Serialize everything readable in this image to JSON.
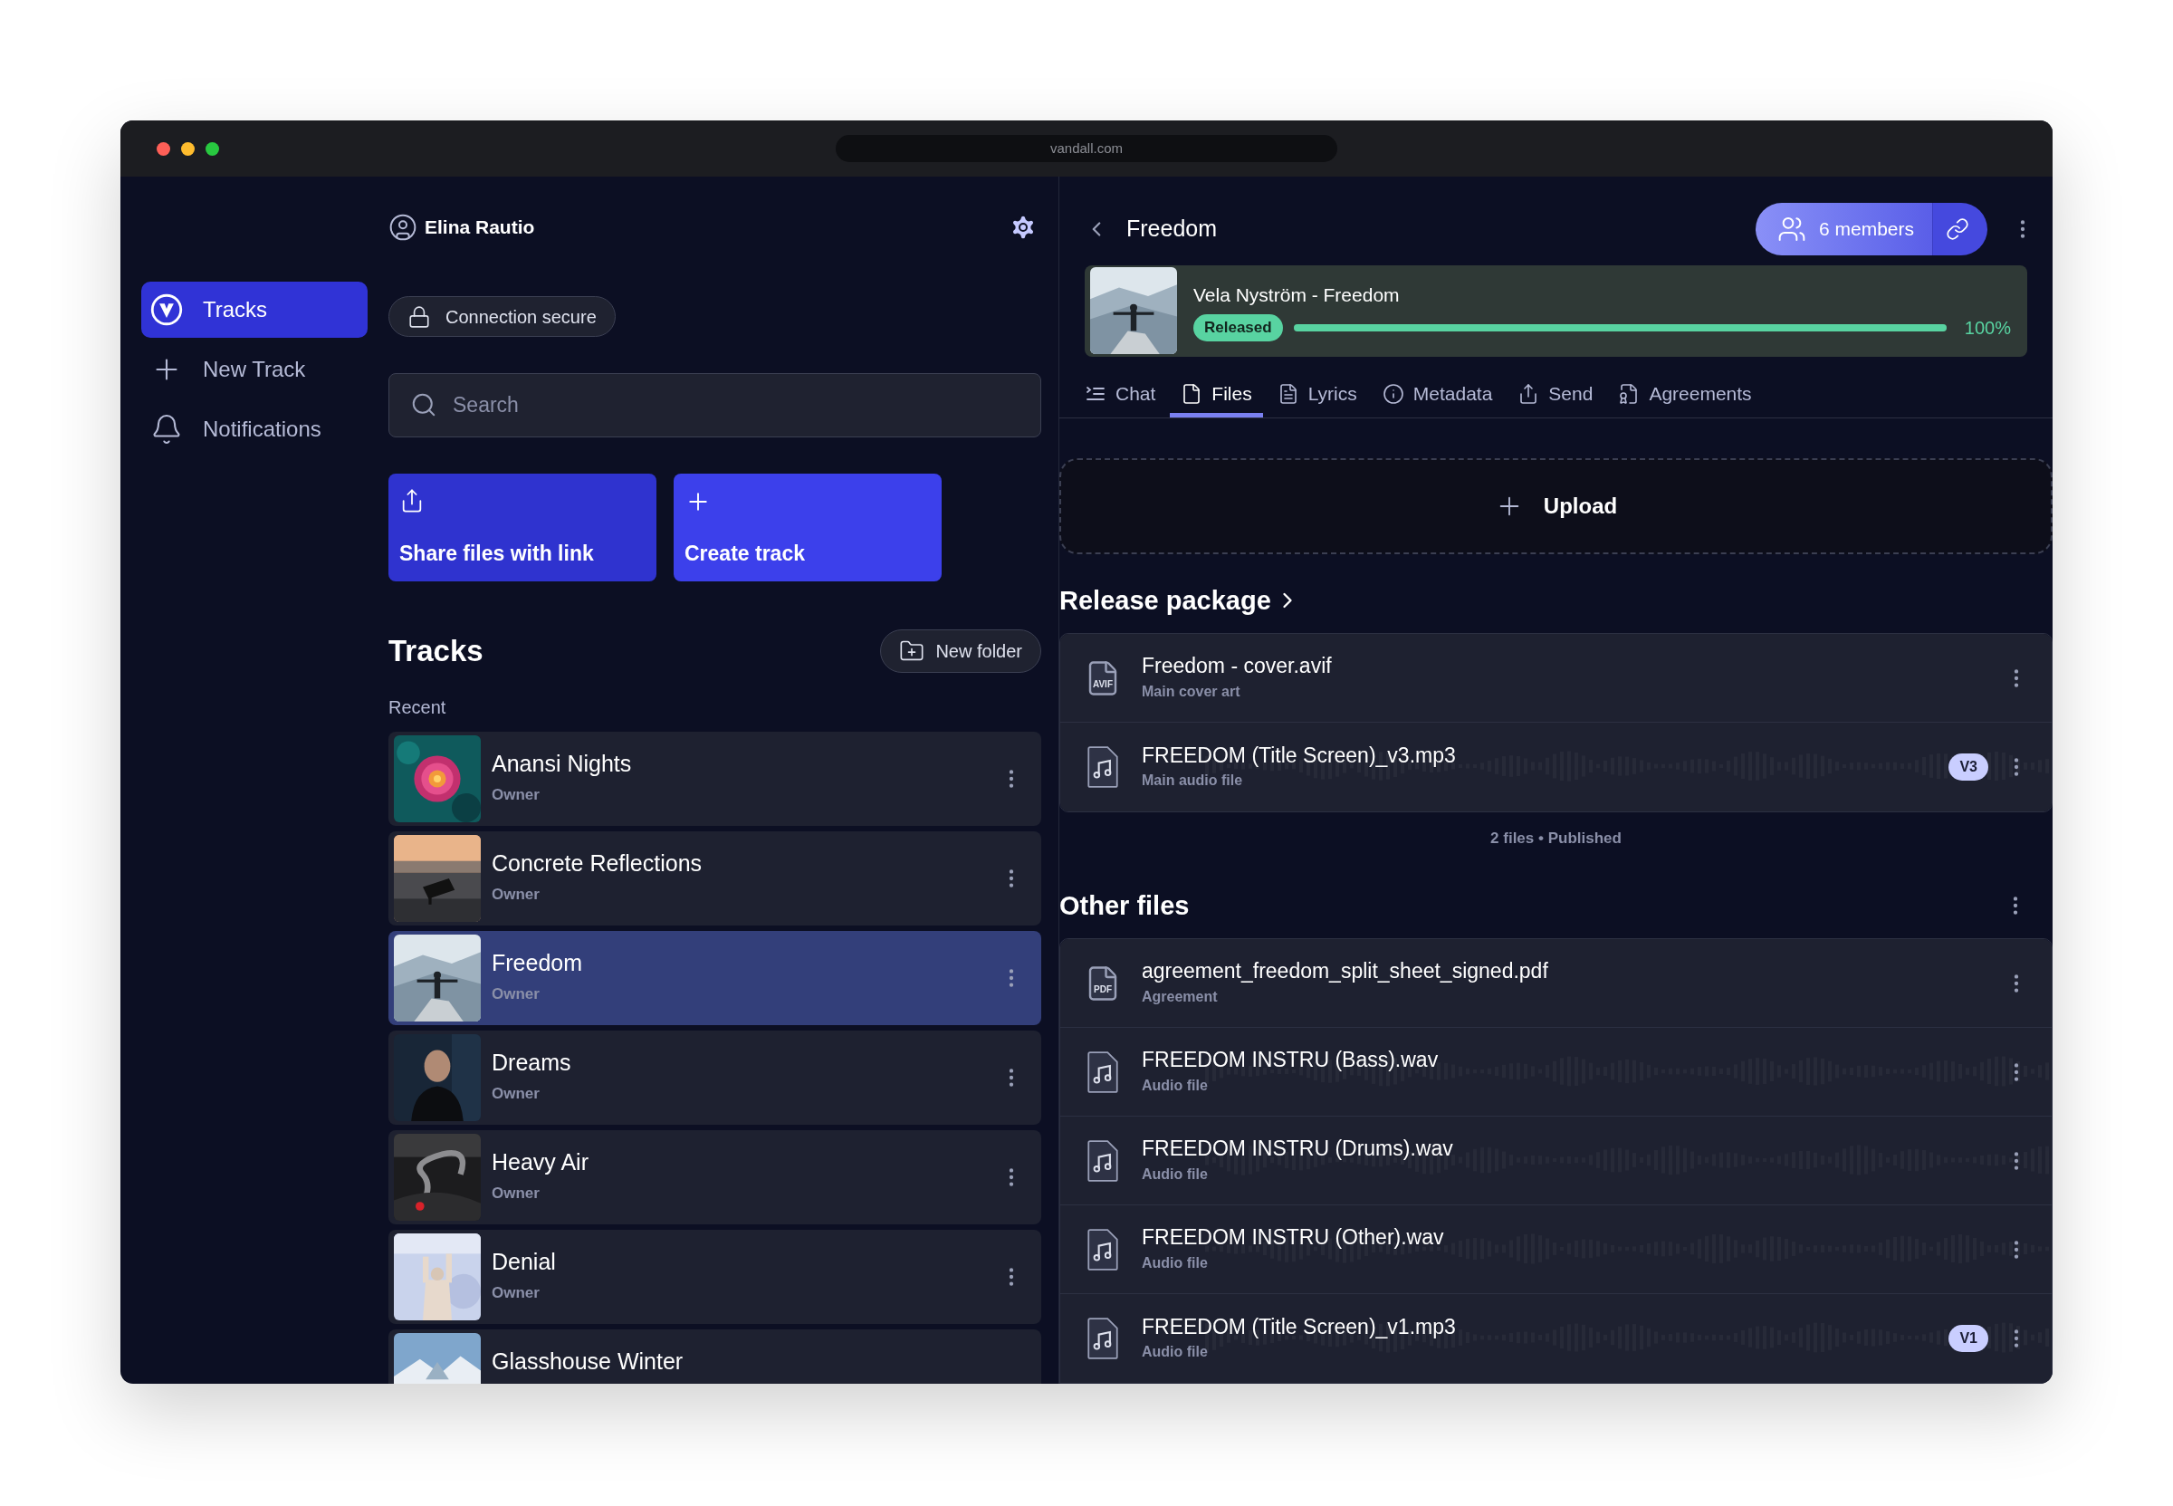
{
  "browser": {
    "url": "vandall.com"
  },
  "sidebar": {
    "items": [
      {
        "label": "Tracks",
        "selected": true
      },
      {
        "label": "New Track",
        "selected": false
      },
      {
        "label": "Notifications",
        "selected": false
      }
    ]
  },
  "user": {
    "name": "Elina Rautio"
  },
  "connection": {
    "label": "Connection secure"
  },
  "search": {
    "placeholder": "Search"
  },
  "actions": [
    {
      "label": "Share files with link"
    },
    {
      "label": "Create track"
    }
  ],
  "tracks": {
    "title": "Tracks",
    "new_folder": "New folder",
    "section": "Recent",
    "items": [
      {
        "title": "Anansi Nights",
        "role": "Owner",
        "selected": false
      },
      {
        "title": "Concrete Reflections",
        "role": "Owner",
        "selected": false
      },
      {
        "title": "Freedom",
        "role": "Owner",
        "selected": true
      },
      {
        "title": "Dreams",
        "role": "Owner",
        "selected": false
      },
      {
        "title": "Heavy Air",
        "role": "Owner",
        "selected": false
      },
      {
        "title": "Denial",
        "role": "Owner",
        "selected": false
      },
      {
        "title": "Glasshouse Winter",
        "selected": false
      }
    ]
  },
  "detail": {
    "title": "Freedom",
    "members": "6 members",
    "release": {
      "title": "Vela Nyström - Freedom",
      "status": "Released",
      "level": 1,
      "percent": "100%"
    },
    "tabs": [
      {
        "label": "Chat",
        "selected": false
      },
      {
        "label": "Files",
        "selected": true
      },
      {
        "label": "Lyrics",
        "selected": false
      },
      {
        "label": "Metadata",
        "selected": false
      },
      {
        "label": "Send",
        "selected": false
      },
      {
        "label": "Agreements",
        "selected": false
      }
    ],
    "upload": "Upload",
    "release_package": {
      "title": "Release package",
      "summary": "2 files • Published",
      "files": [
        {
          "name": "Freedom - cover.avif",
          "type": "Main cover art",
          "kind": "document",
          "icon_label": "AVIF"
        },
        {
          "name": "FREEDOM (Title Screen)_v3.mp3",
          "type": "Main audio file",
          "kind": "audio",
          "version": "V3"
        }
      ]
    },
    "other_files": {
      "title": "Other files",
      "files": [
        {
          "name": "agreement_freedom_split_sheet_signed.pdf",
          "type": "Agreement",
          "kind": "document",
          "icon_label": "PDF"
        },
        {
          "name": "FREEDOM INSTRU (Bass).wav",
          "type": "Audio file",
          "kind": "audio"
        },
        {
          "name": "FREEDOM INSTRU (Drums).wav",
          "type": "Audio file",
          "kind": "audio"
        },
        {
          "name": "FREEDOM INSTRU (Other).wav",
          "type": "Audio file",
          "kind": "audio"
        },
        {
          "name": "FREEDOM (Title Screen)_v1.mp3",
          "type": "Audio file",
          "kind": "audio",
          "version": "V1"
        }
      ]
    }
  }
}
